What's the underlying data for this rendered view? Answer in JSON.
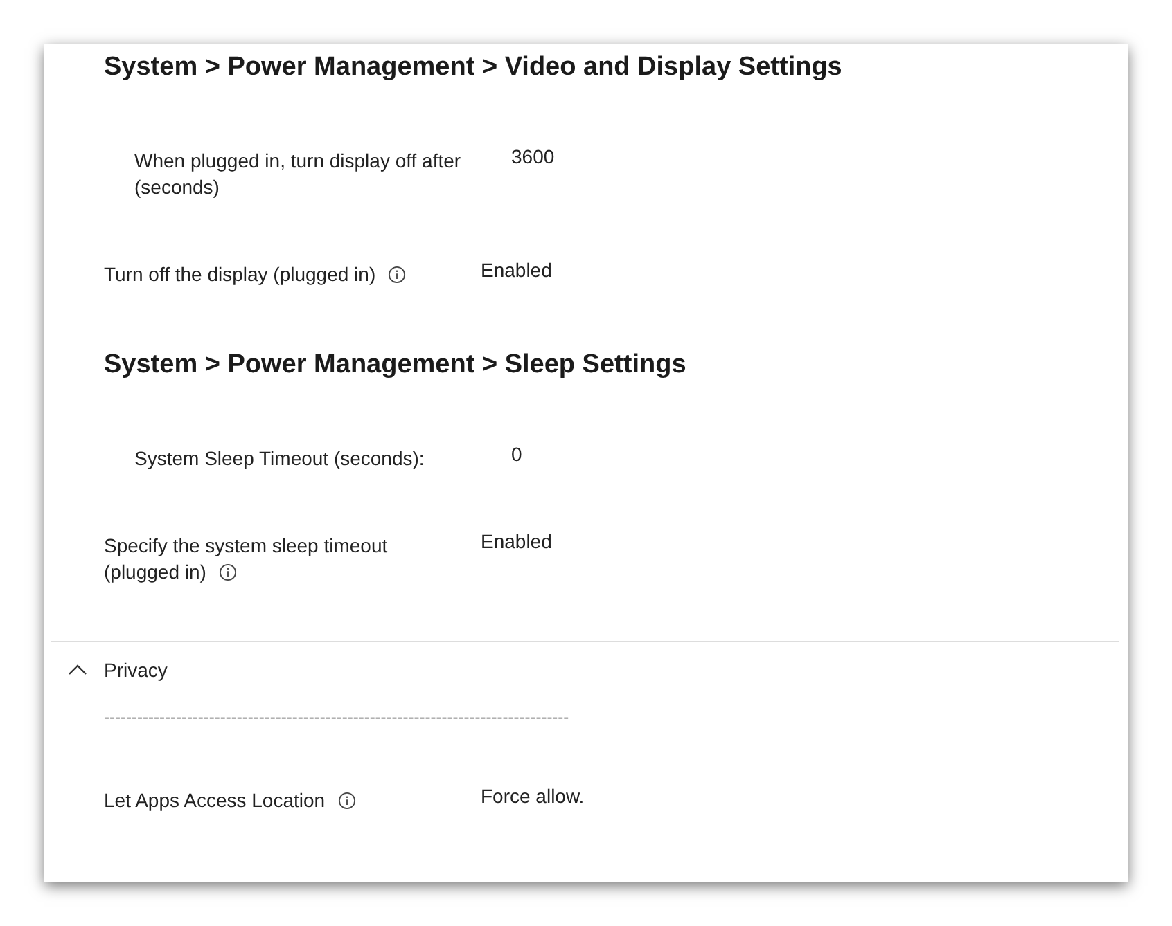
{
  "sections": [
    {
      "title": "System > Power Management > Video and Display Settings",
      "rows": [
        {
          "kind": "sub",
          "label": "When plugged in, turn display off after (seconds)",
          "value": "3600"
        },
        {
          "kind": "policy",
          "label": "Turn off the display (plugged in)",
          "value": "Enabled"
        }
      ]
    },
    {
      "title": "System > Power Management > Sleep Settings",
      "rows": [
        {
          "kind": "sub",
          "label": "System Sleep Timeout (seconds):",
          "value": "0"
        },
        {
          "kind": "policy",
          "label": "Specify the system sleep timeout (plugged in)",
          "value": "Enabled"
        }
      ]
    }
  ],
  "privacy": {
    "title": "Privacy",
    "expanded": true,
    "separator": "------------------------------------------------------------------------------------",
    "rows": [
      {
        "kind": "policy",
        "label": "Let Apps Access Location",
        "value": "Force allow."
      }
    ]
  }
}
